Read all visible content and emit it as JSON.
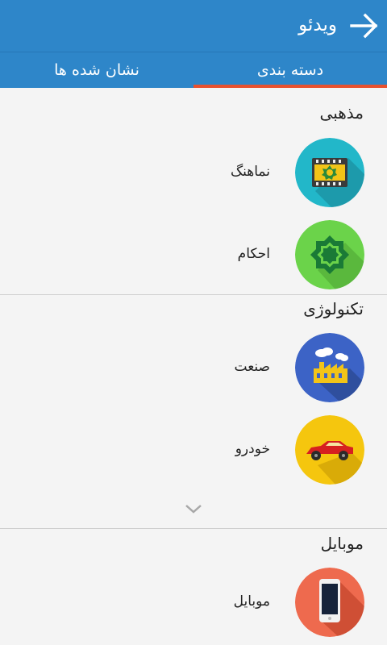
{
  "appbar": {
    "title": "ویدئو",
    "back_icon": "arrow-right-icon"
  },
  "tabs": [
    {
      "label": "دسته بندی",
      "selected": true
    },
    {
      "label": "نشان شده ها",
      "selected": false
    }
  ],
  "sections": [
    {
      "title": "مذهبی",
      "items": [
        {
          "label": "نماهنگ",
          "icon": "film-reel-icon",
          "color": "#22b7c9"
        },
        {
          "label": "احکام",
          "icon": "islamic-star-icon",
          "color": "#6bd34a"
        }
      ]
    },
    {
      "title": "تکنولوژی",
      "items": [
        {
          "label": "صنعت",
          "icon": "factory-icon",
          "color": "#3c63c6"
        },
        {
          "label": "خودرو",
          "icon": "car-icon",
          "color": "#f5c60e"
        }
      ],
      "expand_icon": "chevron-down-icon"
    },
    {
      "title": "موبایل",
      "items": [
        {
          "label": "موبایل",
          "icon": "mobile-phone-icon",
          "color": "#ee6a4e"
        }
      ]
    }
  ],
  "colors": {
    "primary": "#2e86c9",
    "tab_indicator": "#e8512e",
    "background": "#f4f4f4"
  }
}
